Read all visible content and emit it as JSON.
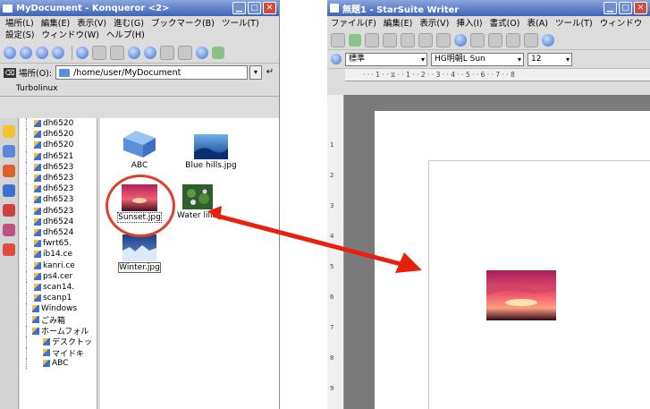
{
  "konqueror": {
    "title": "MyDocument - Konqueror <2>",
    "menu_row1": [
      "場所(L)",
      "編集(E)",
      "表示(V)",
      "進む(G)",
      "ブックマーク(B)",
      "ツール(T)"
    ],
    "menu_row2": [
      "設定(S)",
      "ウィンドウ(W)",
      "ヘルプ(H)"
    ],
    "location_label": "場所(O):",
    "location_value": "/home/user/MyDocument",
    "tab_label": "Turbolinux",
    "tree_items": [
      "dh6520",
      "dh6520",
      "dh6520",
      "dh6521",
      "dh6523",
      "dh6523",
      "dh6523",
      "dh6523",
      "dh6523",
      "dh6524",
      "dh6524",
      "fwrt65.",
      "ib14.ce",
      "kanri.ce",
      "ps4.cer",
      "scan14.",
      "scanp1",
      "Windows",
      "ごみ箱",
      "ホームフォル",
      "デスクトッ",
      "マイドキ",
      "ABC"
    ],
    "files": [
      {
        "name": "ABC",
        "type": "folder"
      },
      {
        "name": "Blue hills.jpg",
        "type": "image"
      },
      {
        "name": "Sunset.jpg",
        "type": "image",
        "selected": true
      },
      {
        "name": "Water lilies.jpg",
        "type": "image"
      },
      {
        "name": "Winter.jpg",
        "type": "image"
      }
    ]
  },
  "writer": {
    "title": "無題1 - StarSuite Writer",
    "menu": [
      "ファイル(F)",
      "編集(E)",
      "表示(V)",
      "挿入(I)",
      "書式(O)",
      "表(A)",
      "ツール(T)",
      "ウィンドウ"
    ],
    "style_value": "標準",
    "font_value": "HG明朝L Sun",
    "size_value": "12",
    "ruler_text": "· · · 1 · · ⧖ · · 1 · · 2 · · 3 · · 4 · · 5 · · 6 · · 7 · · 8",
    "vruler_marks": [
      "1",
      "2",
      "3",
      "4",
      "5",
      "6",
      "7",
      "8",
      "9"
    ],
    "inserted_image": "Sunset.jpg"
  },
  "colors": {
    "title_gradient_top": "#8aa6dd",
    "title_gradient_bottom": "#3e63b8",
    "annotation_red": "#e0402a"
  }
}
